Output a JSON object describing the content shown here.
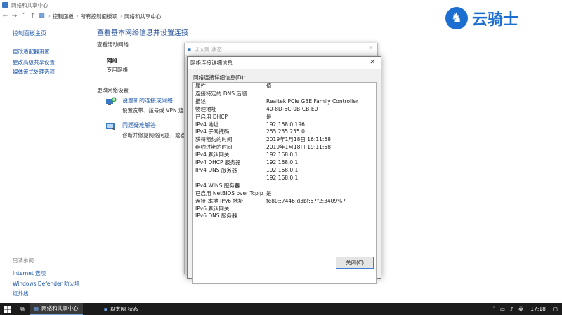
{
  "window": {
    "title": "网络和共享中心"
  },
  "address": {
    "crumbs": [
      "控制面板",
      "所有控制面板项",
      "网络和共享中心"
    ]
  },
  "left_nav": {
    "title": "控制面板主页",
    "links": [
      "更改适配器设置",
      "更改高级共享设置",
      "媒体流式处理选项"
    ]
  },
  "see_also": {
    "label": "另请参阅",
    "links": [
      "Internet 选项",
      "Windows Defender 防火墙",
      "红外线"
    ]
  },
  "content": {
    "heading": "查看基本网络信息并设置连接",
    "active_networks_label": "查看活动网络",
    "network_name": "网络",
    "network_type": "专用网络",
    "change_settings_label": "更改网络设置",
    "task1_link": "设置新的连接或网络",
    "task1_desc": "设置宽带、拨号或 VPN 连接",
    "task2_link": "问题疑难解答",
    "task2_desc": "诊断并修复网络问题，或者"
  },
  "watermark": {
    "text": "云骑士"
  },
  "status_dialog": {
    "title": "以太网 状态"
  },
  "details_dialog": {
    "title": "网络连接详细信息",
    "label": "网络连接详细信息(D):",
    "header": {
      "property": "属性",
      "value": "值"
    },
    "rows": [
      [
        "连接特定的 DNS 后缀",
        ""
      ],
      [
        "描述",
        "Realtek PCIe GBE Family Controller"
      ],
      [
        "物理地址",
        "40-8D-5C-0B-CB-E0"
      ],
      [
        "已启用 DHCP",
        "是"
      ],
      [
        "IPv4 地址",
        "192.168.0.196"
      ],
      [
        "IPv4 子网掩码",
        "255.255.255.0"
      ],
      [
        "获得租约的时间",
        "2019年1月18日 16:11:58"
      ],
      [
        "租约过期的时间",
        "2019年1月18日 19:11:58"
      ],
      [
        "IPv4 默认网关",
        "192.168.0.1"
      ],
      [
        "IPv4 DHCP 服务器",
        "192.168.0.1"
      ],
      [
        "IPv4 DNS 服务器",
        "192.168.0.1"
      ],
      [
        "",
        "192.168.0.1"
      ],
      [
        "IPv4 WINS 服务器",
        ""
      ],
      [
        "已启用 NetBIOS over Tcpip",
        "是"
      ],
      [
        "连接-本地 IPv6 地址",
        "fe80::7446:d3bf:57f2:3409%7"
      ],
      [
        "IPv6 默认网关",
        ""
      ],
      [
        "IPv6 DNS 服务器",
        ""
      ]
    ],
    "close_label": "关闭(C)"
  },
  "taskbar": {
    "items": [
      "网络和共享中心",
      "以太网 状态"
    ],
    "ime": "英",
    "time": "17:18"
  }
}
